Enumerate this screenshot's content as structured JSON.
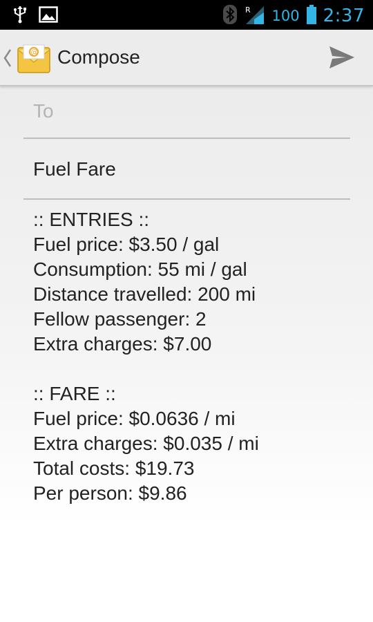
{
  "status_bar": {
    "battery": "100",
    "time": "2:37",
    "icons": [
      "usb-icon",
      "image-icon",
      "bluetooth-icon",
      "signal-roaming-icon",
      "battery-icon"
    ]
  },
  "action_bar": {
    "title": "Compose",
    "icons": [
      "back-caret-icon",
      "email-app-icon",
      "send-icon"
    ]
  },
  "compose": {
    "to_placeholder": "To",
    "subject": "Fuel Fare",
    "body": {
      "entries_header": ":: ENTRIES ::",
      "entries": [
        "Fuel price: $3.50 / gal",
        "Consumption: 55 mi / gal",
        "Distance travelled: 200 mi",
        "Fellow passenger: 2",
        "Extra charges: $7.00"
      ],
      "fare_header": ":: FARE ::",
      "fare": [
        "Fuel price: $0.0636 / mi",
        "Extra charges: $0.035 / mi",
        "Total costs: $19.73",
        "Per person: $9.86"
      ]
    }
  },
  "colors": {
    "accent": "#33b5e5",
    "status_bg": "#000000",
    "action_bar_bg": "#ececec"
  }
}
